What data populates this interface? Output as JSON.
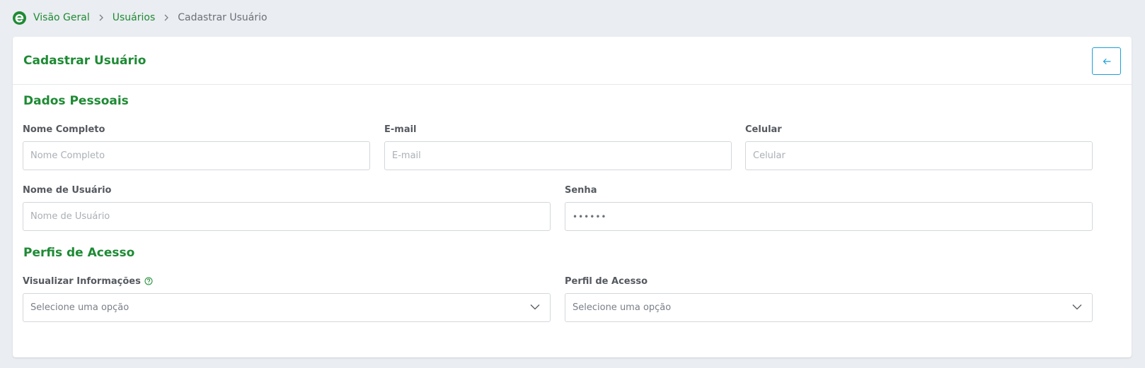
{
  "breadcrumb": {
    "home": "Visão Geral",
    "users": "Usuários",
    "current": "Cadastrar Usuário"
  },
  "page": {
    "title": "Cadastrar Usuário",
    "back_icon": "arrow-left-icon"
  },
  "personal": {
    "section_title": "Dados Pessoais",
    "full_name": {
      "label": "Nome Completo",
      "placeholder": "Nome Completo"
    },
    "email": {
      "label": "E-mail",
      "placeholder": "E-mail"
    },
    "phone": {
      "label": "Celular",
      "placeholder": "Celular"
    },
    "username": {
      "label": "Nome de Usuário",
      "placeholder": "Nome de Usuário"
    },
    "password": {
      "label": "Senha",
      "value": "••••••"
    }
  },
  "access": {
    "section_title": "Perfis de Acesso",
    "view_info": {
      "label": "Visualizar Informações",
      "value": "Selecione uma opção"
    },
    "profile": {
      "label": "Perfil de Acesso",
      "value": "Selecione uma opção"
    }
  },
  "colors": {
    "brand_green": "#1e8a34",
    "accent_blue": "#1aa0d8",
    "background": "#eaedf1"
  }
}
